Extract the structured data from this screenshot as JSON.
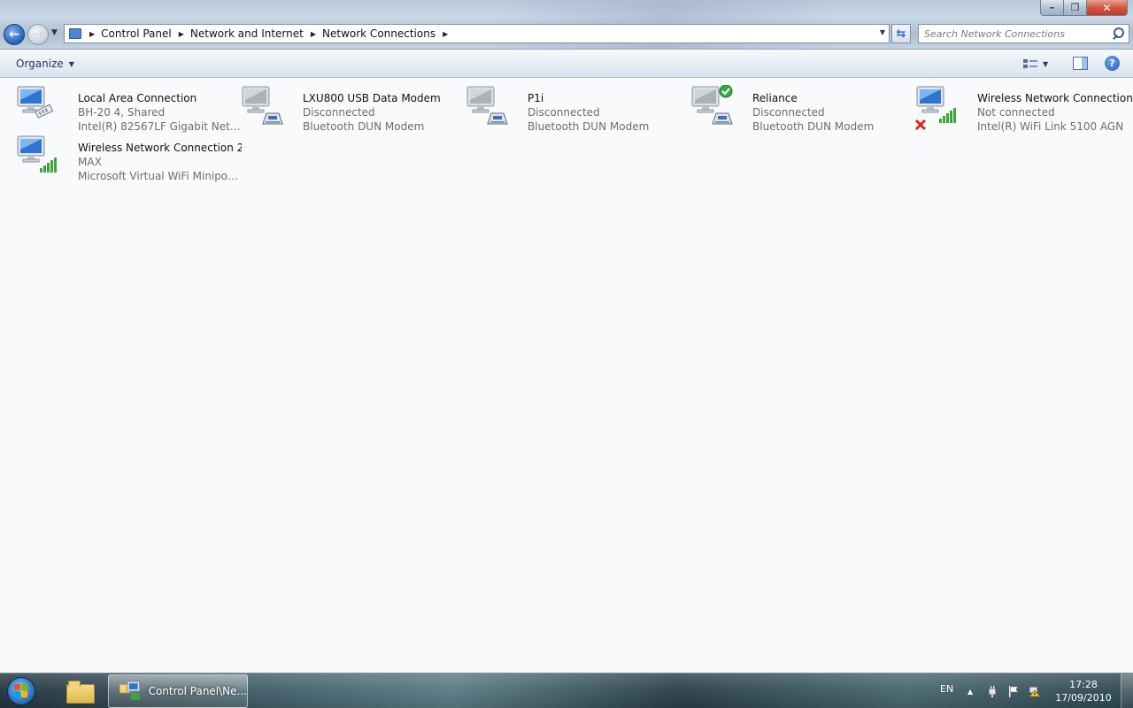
{
  "window": {
    "minimize_glyph": "–",
    "restore_glyph": "❐",
    "close_glyph": "✕"
  },
  "navigation": {
    "back_glyph": "←",
    "forward_glyph": "→"
  },
  "address_bar": {
    "breadcrumbs": [
      "Control Panel",
      "Network and Internet",
      "Network Connections"
    ]
  },
  "search": {
    "placeholder": "Search Network Connections"
  },
  "command_bar": {
    "organize_label": "Organize",
    "help_glyph": "?"
  },
  "connections": [
    {
      "name": "Local Area Connection",
      "status": "BH-20  4, Shared",
      "device": "Intel(R) 82567LF Gigabit Network ...",
      "icon": "ethernet-network-icon"
    },
    {
      "name": "LXU800 USB Data Modem",
      "status": "Disconnected",
      "device": "Bluetooth DUN Modem",
      "icon": "modem-network-icon"
    },
    {
      "name": "P1i",
      "status": "Disconnected",
      "device": "Bluetooth DUN Modem",
      "icon": "modem-network-icon"
    },
    {
      "name": "Reliance",
      "status": "Disconnected",
      "device": "Bluetooth DUN Modem",
      "icon": "modem-network-default-icon"
    },
    {
      "name": "Wireless Network Connection",
      "status": "Not connected",
      "device": "Intel(R) WiFi Link 5100 AGN",
      "icon": "wireless-network-disconnected-icon"
    },
    {
      "name": "Wireless Network Connection 2",
      "status": "MAX",
      "device": "Microsoft Virtual WiFi Miniport A...",
      "icon": "wireless-network-icon"
    }
  ],
  "taskbar": {
    "active_window_label": "Control Panel\\Ne...",
    "language": "EN",
    "time": "17:28",
    "date": "17/09/2010"
  },
  "colors": {
    "status_gray": "#6d6d6d",
    "signal_green": "#3da53a",
    "error_red": "#d62a1e",
    "check_green": "#37a844"
  }
}
